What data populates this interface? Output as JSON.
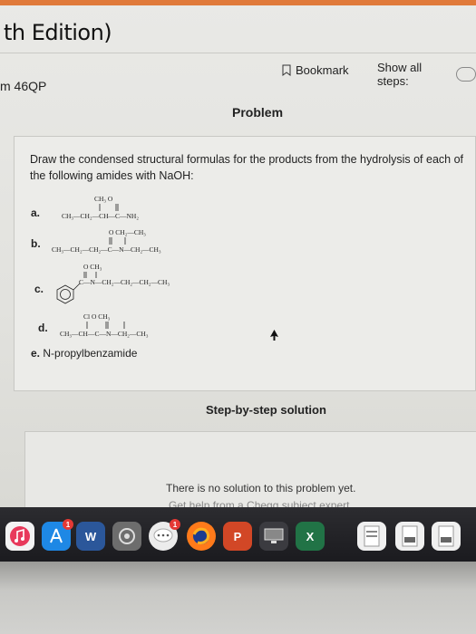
{
  "header": {
    "edition": "th Edition)",
    "question_id": "m 46QP",
    "bookmark_label": "Bookmark",
    "show_steps_label": "Show all steps:"
  },
  "problem": {
    "tab_label": "Problem",
    "statement": "Draw the condensed structural formulas for the products from the hydrolysis of each of the following amides with NaOH:",
    "items": {
      "a": {
        "letter": "a.",
        "top": "CH₃  O",
        "main": "CH₃—CH₂—CH—C—NH₂"
      },
      "b": {
        "letter": "b.",
        "top": "O  CH₂—CH₃",
        "main": "CH₃—CH₂—CH₂—C—N—CH₂—CH₃"
      },
      "c": {
        "letter": "c.",
        "top": "O  CH₃",
        "main": "C—N—CH₂—CH₂—CH₂—CH₃"
      },
      "d": {
        "letter": "d.",
        "top": "Cl   O  CH₃",
        "main": "CH₃—CH—C—N—CH₂—CH₃"
      },
      "e": {
        "letter": "e.",
        "text": "N-propylbenzamide"
      }
    }
  },
  "solution": {
    "tab_label": "Step-by-step solution",
    "no_solution": "There is no solution to this problem yet.",
    "get_help": "Get help from a Chegg subject expert."
  },
  "dock": {
    "word_label": "W",
    "powerpoint_label": "P",
    "excel_label": "X",
    "badges": [
      "1",
      "1"
    ],
    "icons": [
      "itunes-icon",
      "app-store-icon",
      "word-icon",
      "steam-icon",
      "messages-icon",
      "firefox-icon",
      "powerpoint-icon",
      "monitor-icon",
      "excel-icon",
      "pdf-icon",
      "file-icon",
      "document-icon"
    ]
  },
  "colors": {
    "accent": "#e07a3a",
    "page": "#e9e9e6",
    "dock": "#1f1f23"
  }
}
